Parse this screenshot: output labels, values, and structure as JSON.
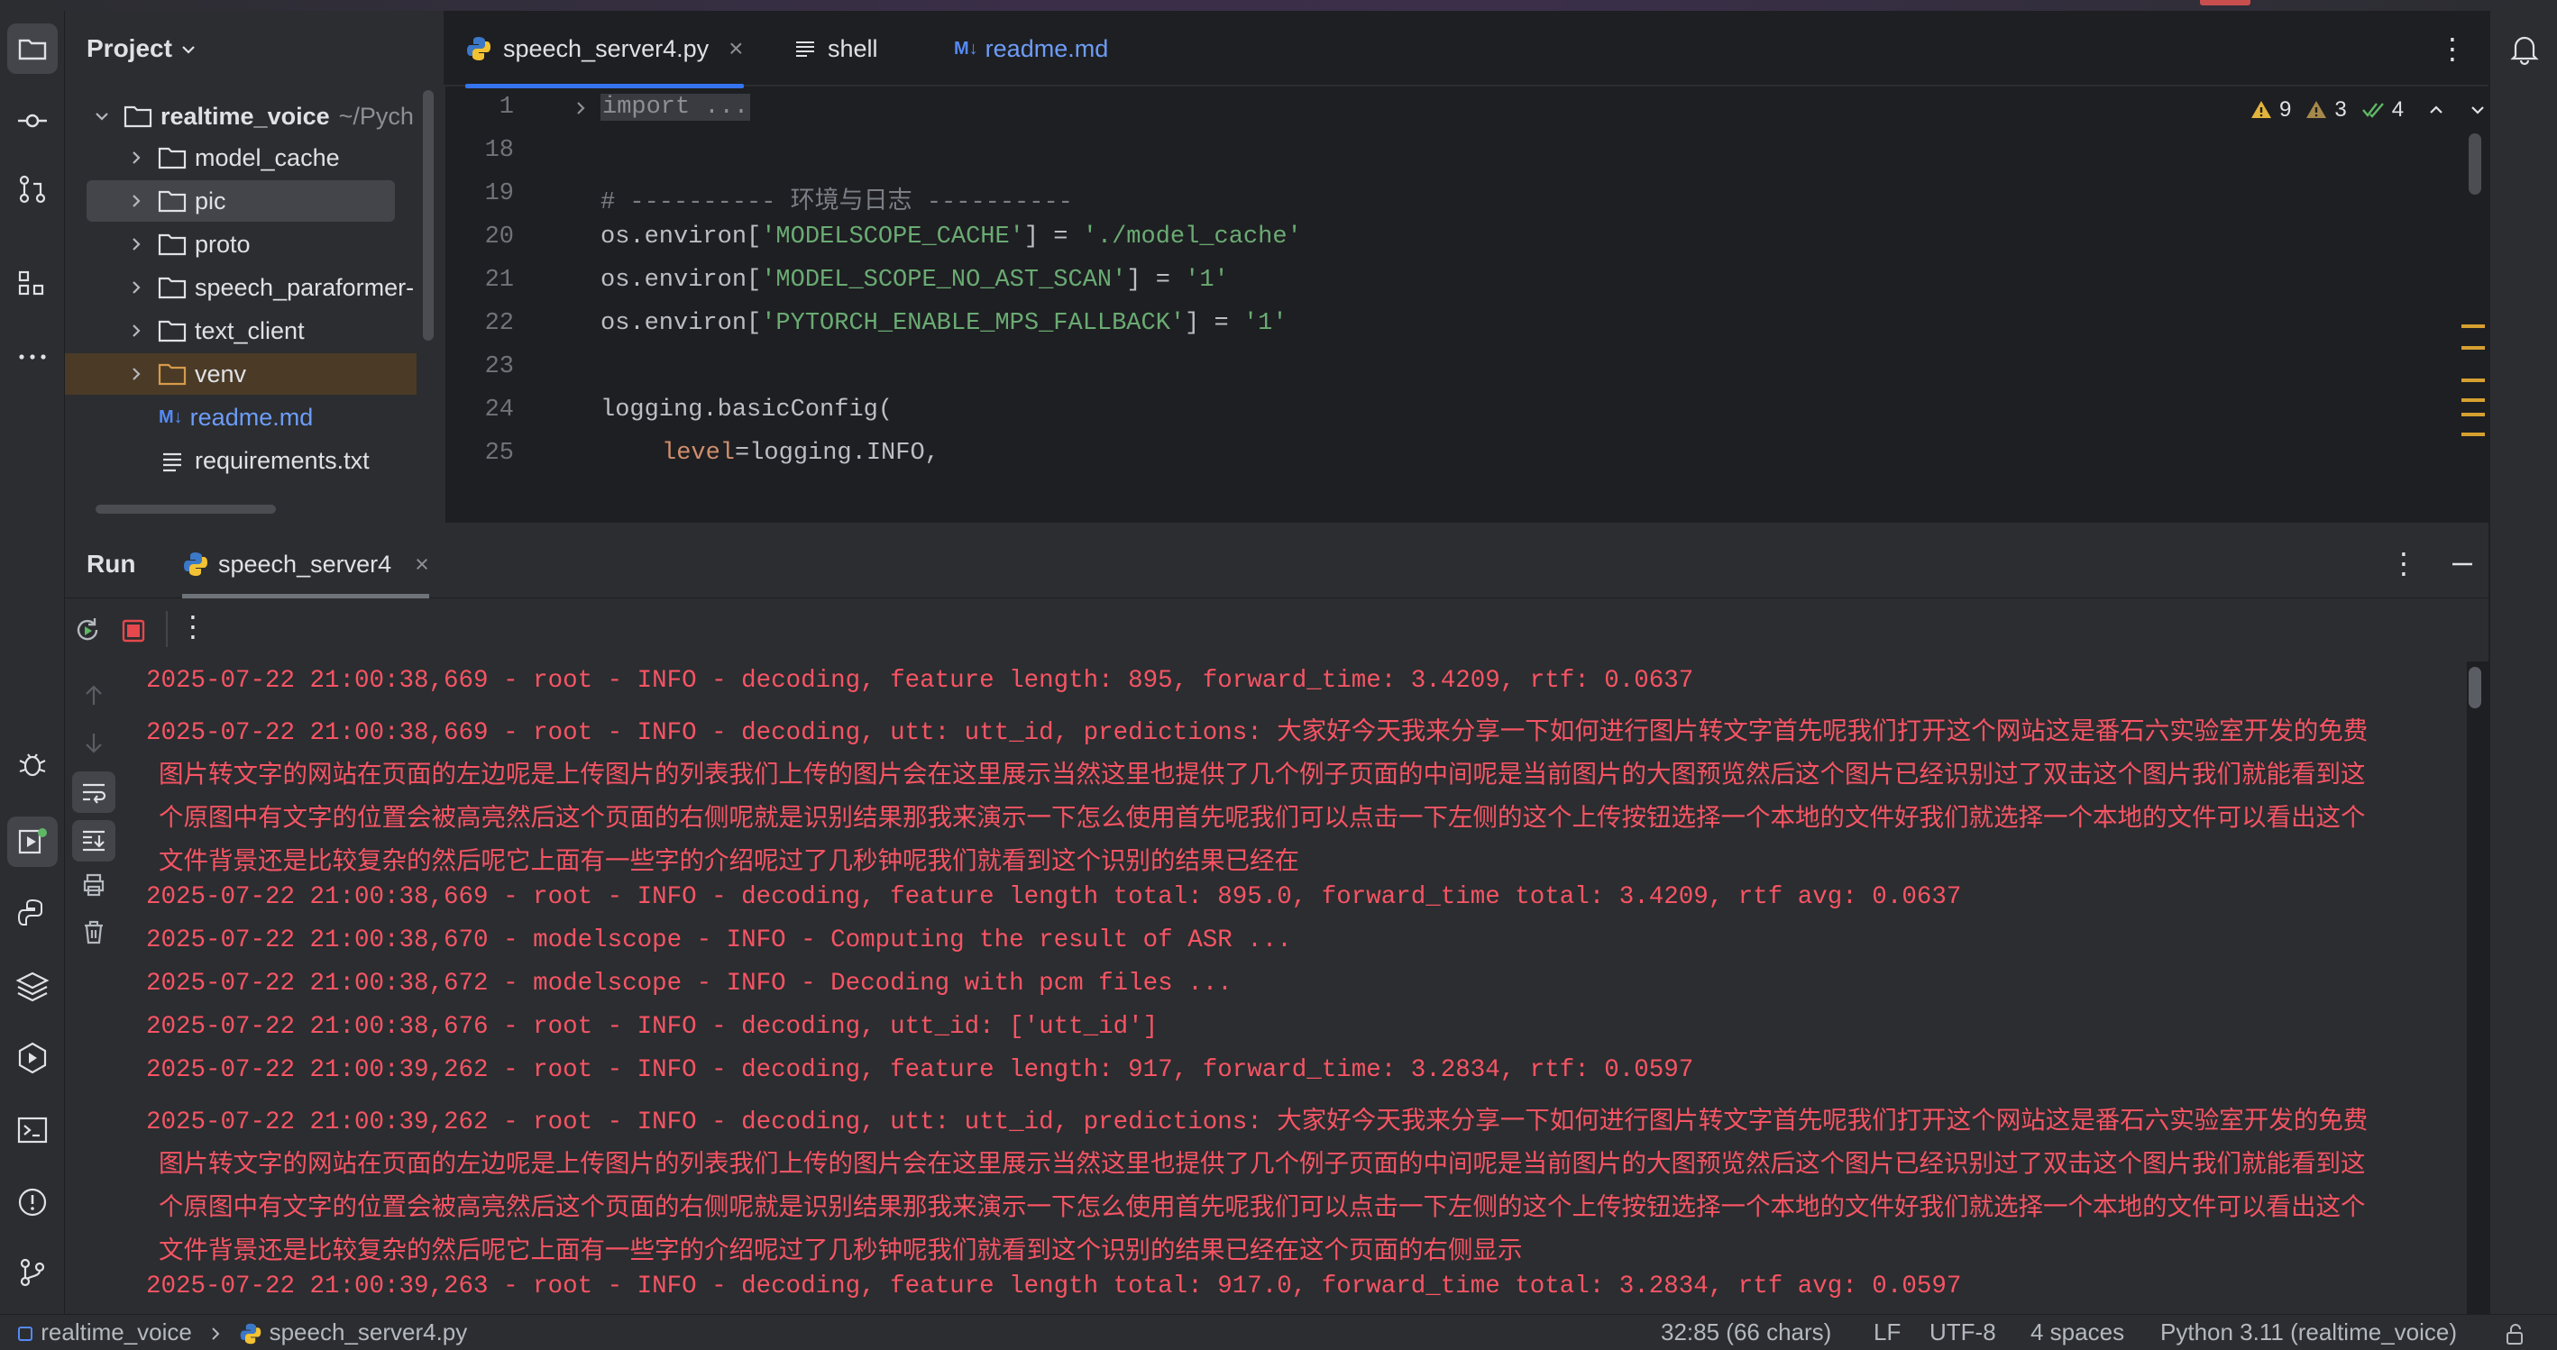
{
  "project": {
    "title": "Project",
    "root": {
      "name": "realtime_voice",
      "path": "~/Pych"
    },
    "items": [
      {
        "label": "model_cache",
        "type": "folder"
      },
      {
        "label": "pic",
        "type": "folder"
      },
      {
        "label": "proto",
        "type": "folder"
      },
      {
        "label": "speech_paraformer-",
        "type": "folder"
      },
      {
        "label": "text_client",
        "type": "folder"
      },
      {
        "label": "venv",
        "type": "folder"
      },
      {
        "label": "readme.md",
        "type": "markdown",
        "icon": "M↓"
      },
      {
        "label": "requirements.txt",
        "type": "text"
      }
    ]
  },
  "editor": {
    "tabs": [
      {
        "label": "speech_server4.py",
        "icon": "python-icon",
        "active": true,
        "close": "×"
      },
      {
        "label": "shell",
        "icon": "text-lines-icon"
      },
      {
        "label": "readme.md",
        "icon": "M↓"
      }
    ],
    "inspections": {
      "warnings": "9",
      "weak_warnings": "3",
      "ok": "4"
    },
    "lines": [
      {
        "num": "1",
        "text": "import ..."
      },
      {
        "num": "18",
        "text": ""
      },
      {
        "num": "19",
        "text": "# ---------- 环境与日志 ----------"
      },
      {
        "num": "20",
        "pre": "os.environ[",
        "str": "'MODELSCOPE_CACHE'",
        "mid": "] = ",
        "str2": "'./model_cache'"
      },
      {
        "num": "21",
        "pre": "os.environ[",
        "str": "'MODEL_SCOPE_NO_AST_SCAN'",
        "mid": "] = ",
        "str2": "'1'"
      },
      {
        "num": "22",
        "pre": "os.environ[",
        "str": "'PYTORCH_ENABLE_MPS_FALLBACK'",
        "mid": "] = ",
        "str2": "'1'"
      },
      {
        "num": "23",
        "text": ""
      },
      {
        "num": "24",
        "text": "logging.basicConfig("
      },
      {
        "num": "25",
        "kw": "level",
        "text": "=logging.INFO,"
      }
    ]
  },
  "run": {
    "title": "Run",
    "tab": "speech_server4",
    "close": "×",
    "console": [
      "2025-07-22 21:00:38,669 - root - INFO - decoding, feature length: 895, forward_time: 3.4209, rtf: 0.0637",
      "2025-07-22 21:00:38,669 - root - INFO - decoding, utt: utt_id, predictions: 大家好今天我来分享一下如何进行图片转文字首先呢我们打开这个网站这是番石六实验室开发的免费",
      "图片转文字的网站在页面的左边呢是上传图片的列表我们上传的图片会在这里展示当然这里也提供了几个例子页面的中间呢是当前图片的大图预览然后这个图片已经识别过了双击这个图片我们就能看到这",
      "个原图中有文字的位置会被高亮然后这个页面的右侧呢就是识别结果那我来演示一下怎么使用首先呢我们可以点击一下左侧的这个上传按钮选择一个本地的文件好我们就选择一个本地的文件可以看出这个",
      "文件背景还是比较复杂的然后呢它上面有一些字的介绍呢过了几秒钟呢我们就看到这个识别的结果已经在",
      "2025-07-22 21:00:38,669 - root - INFO - decoding, feature length total: 895.0, forward_time total: 3.4209, rtf avg: 0.0637",
      "2025-07-22 21:00:38,670 - modelscope - INFO - Computing the result of ASR ...",
      "2025-07-22 21:00:38,672 - modelscope - INFO - Decoding with pcm files ...",
      "2025-07-22 21:00:38,676 - root - INFO - decoding, utt_id: ['utt_id']",
      "2025-07-22 21:00:39,262 - root - INFO - decoding, feature length: 917, forward_time: 3.2834, rtf: 0.0597",
      "2025-07-22 21:00:39,262 - root - INFO - decoding, utt: utt_id, predictions: 大家好今天我来分享一下如何进行图片转文字首先呢我们打开这个网站这是番石六实验室开发的免费",
      "图片转文字的网站在页面的左边呢是上传图片的列表我们上传的图片会在这里展示当然这里也提供了几个例子页面的中间呢是当前图片的大图预览然后这个图片已经识别过了双击这个图片我们就能看到这",
      "个原图中有文字的位置会被高亮然后这个页面的右侧呢就是识别结果那我来演示一下怎么使用首先呢我们可以点击一下左侧的这个上传按钮选择一个本地的文件好我们就选择一个本地的文件可以看出这个",
      "文件背景还是比较复杂的然后呢它上面有一些字的介绍呢过了几秒钟呢我们就看到这个识别的结果已经在这个页面的右侧显示",
      "2025-07-22 21:00:39,263 - root - INFO - decoding, feature length total: 917.0, forward_time total: 3.2834, rtf avg: 0.0597"
    ]
  },
  "statusbar": {
    "breadcrumb": [
      "realtime_voice",
      "speech_server4.py"
    ],
    "position": "32:85 (66 chars)",
    "line_sep": "LF",
    "encoding": "UTF-8",
    "indent": "4 spaces",
    "interpreter": "Python 3.11 (realtime_voice)"
  },
  "colors": {
    "accent": "#3574f0",
    "console_error": "#f75464",
    "string": "#6aab73",
    "background": "#1e1f22"
  }
}
